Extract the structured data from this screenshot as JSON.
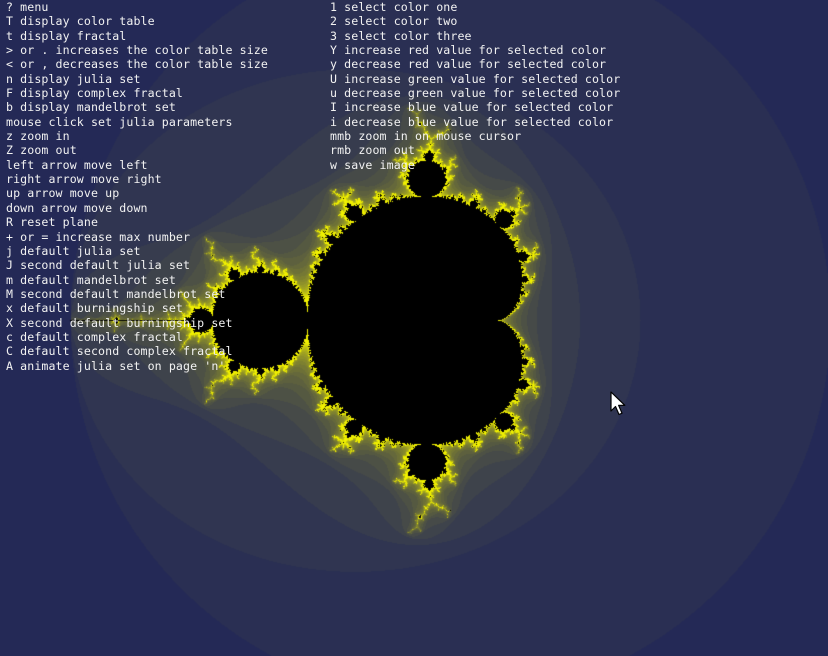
{
  "window": {
    "background_color": "#1f2458",
    "set_color": "#000000",
    "edge_color": "#f0f000"
  },
  "view": {
    "fractal": "mandelbrot set"
  },
  "menu": {
    "left": [
      "? menu",
      "T display color table",
      "t display fractal",
      "> or . increases the color table size",
      "< or , decreases the color table size",
      "n display julia set",
      "F display complex fractal",
      "b display mandelbrot set",
      "mouse click set julia parameters",
      "z zoom in",
      "Z zoom out",
      "left arrow move left",
      "right arrow move right",
      "up arrow move up",
      "down arrow move down",
      "R reset plane",
      "+ or = increase max number",
      "j default julia set",
      "J second default julia set",
      "m default mandelbrot set",
      "M second default mandelbrot set",
      "x default burningship set",
      "X second default burningship set",
      "c default complex fractal",
      "C default second complex fractal",
      "A animate julia set on page 'n'"
    ],
    "right": [
      "1 select color one",
      "2 select color two",
      "3 select color three",
      "Y increase red value for selected color",
      "y decrease red value for selected color",
      "U increase green value for selected color",
      "u decrease green value for selected color",
      "I increase blue value for selected color",
      "i decrease blue value for selected color",
      "mmb zoom in on mouse cursor",
      "rmb zoom out",
      "w save image"
    ]
  },
  "cursor": {
    "icon": "arrow-pointer-icon"
  }
}
